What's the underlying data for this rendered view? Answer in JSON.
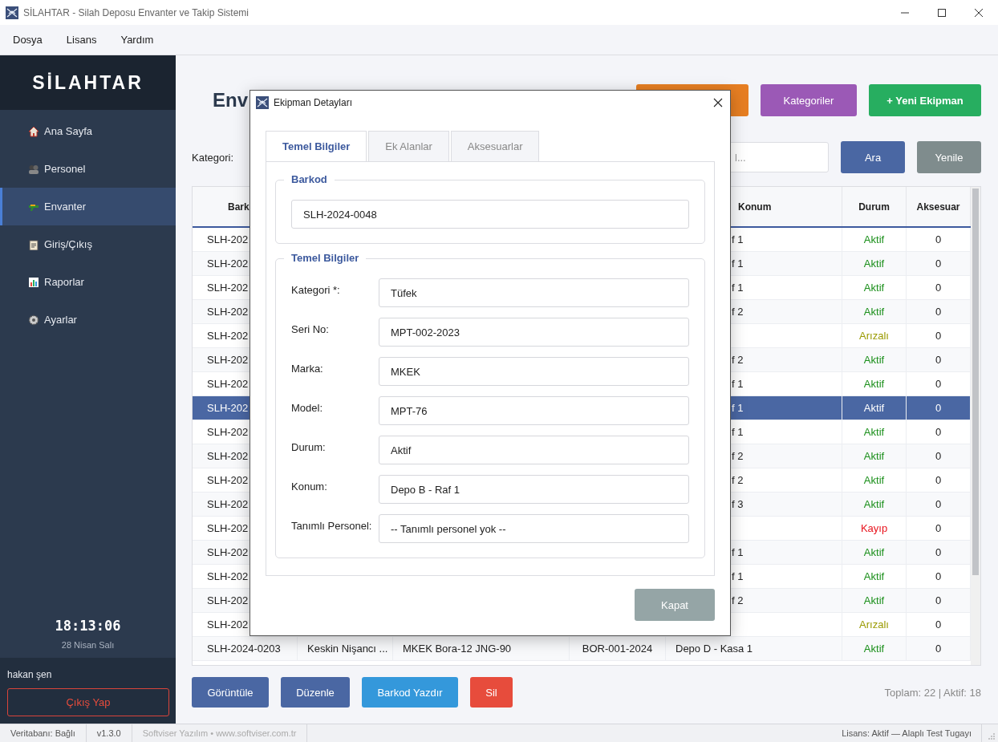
{
  "window": {
    "title": "SİLAHTAR - Silah Deposu Envanter ve Takip Sistemi"
  },
  "menu": [
    "Dosya",
    "Lisans",
    "Yardım"
  ],
  "sidebar": {
    "logo": "SİLAHTAR",
    "items": [
      {
        "label": "Ana Sayfa",
        "selected": false
      },
      {
        "label": "Personel",
        "selected": false
      },
      {
        "label": "Envanter",
        "selected": true
      },
      {
        "label": "Giriş/Çıkış",
        "selected": false
      },
      {
        "label": "Raporlar",
        "selected": false
      },
      {
        "label": "Ayarlar",
        "selected": false
      }
    ],
    "clock": "18:13:06",
    "date": "28 Nisan Salı",
    "user": "hakan şen",
    "logout": "Çıkış Yap"
  },
  "page": {
    "title": "Env",
    "header_buttons": [
      {
        "kind": "export"
      },
      {
        "label": "Kategoriler",
        "kind": "category"
      },
      {
        "label": "+ Yeni Ekipman",
        "kind": "new"
      }
    ]
  },
  "filter": {
    "label": "Kategori:",
    "search_placeholder": "l...",
    "buttons": [
      {
        "label": "Ara",
        "kind": "primary"
      },
      {
        "label": "Yenile",
        "kind": "secondary"
      }
    ]
  },
  "table": {
    "columns": [
      {
        "label": "Bark"
      },
      {},
      {},
      {},
      {
        "label": "Konum"
      },
      {
        "label": "Durum"
      },
      {
        "label": "Aksesuar"
      }
    ],
    "rows": [
      {
        "barkod": "SLH-202",
        "konum": "f 1",
        "durum": "Aktif",
        "kind": "active",
        "aksesuar": "0",
        "selected": false
      },
      {
        "barkod": "SLH-202",
        "konum": "f 1",
        "durum": "Aktif",
        "kind": "active",
        "aksesuar": "0",
        "selected": false
      },
      {
        "barkod": "SLH-202",
        "konum": "f 1",
        "durum": "Aktif",
        "kind": "active",
        "aksesuar": "0",
        "selected": false
      },
      {
        "barkod": "SLH-202",
        "konum": "f 2",
        "durum": "Aktif",
        "kind": "active",
        "aksesuar": "0",
        "selected": false
      },
      {
        "barkod": "SLH-202",
        "durum": "Arızalı",
        "kind": "faulty",
        "aksesuar": "0",
        "selected": false
      },
      {
        "barkod": "SLH-202",
        "konum": "f 2",
        "durum": "Aktif",
        "kind": "active",
        "aksesuar": "0",
        "selected": false
      },
      {
        "barkod": "SLH-202",
        "konum": "f 1",
        "durum": "Aktif",
        "kind": "active",
        "aksesuar": "0",
        "selected": false
      },
      {
        "barkod": "SLH-202",
        "konum": "f 1",
        "durum": "Aktif",
        "aksesuar": "0",
        "selected": true
      },
      {
        "barkod": "SLH-202",
        "konum": "f 1",
        "durum": "Aktif",
        "kind": "active",
        "aksesuar": "0",
        "selected": false
      },
      {
        "barkod": "SLH-202",
        "konum": "f 2",
        "durum": "Aktif",
        "kind": "active",
        "aksesuar": "0",
        "selected": false
      },
      {
        "barkod": "SLH-202",
        "konum": "f 2",
        "durum": "Aktif",
        "kind": "active",
        "aksesuar": "0",
        "selected": false
      },
      {
        "barkod": "SLH-202",
        "konum": "f 3",
        "durum": "Aktif",
        "kind": "active",
        "aksesuar": "0",
        "selected": false
      },
      {
        "barkod": "SLH-202",
        "durum": "Kayıp",
        "kind": "lost",
        "aksesuar": "0",
        "selected": false
      },
      {
        "barkod": "SLH-202",
        "konum": "f 1",
        "durum": "Aktif",
        "kind": "active",
        "aksesuar": "0",
        "selected": false
      },
      {
        "barkod": "SLH-202",
        "konum": "f 1",
        "durum": "Aktif",
        "kind": "active",
        "aksesuar": "0",
        "selected": false
      },
      {
        "barkod": "SLH-202",
        "konum": "f 2",
        "durum": "Aktif",
        "kind": "active",
        "aksesuar": "0",
        "selected": false
      },
      {
        "barkod": "SLH-202",
        "durum": "Arızalı",
        "kind": "faulty",
        "aksesuar": "0",
        "selected": false
      },
      {
        "barkod": "SLH-2024-0203",
        "column_2": "Keskin Nişancı ...",
        "column_3": "MKEK Bora-12 JNG-90",
        "column_4": "BOR-001-2024",
        "konum": "Depo D - Kasa 1",
        "durum": "Aktif",
        "kind": "active",
        "aksesuar": "0",
        "selected": false
      }
    ]
  },
  "actions": [
    {
      "label": "Görüntüle",
      "kind": "primary"
    },
    {
      "label": "Düzenle",
      "kind": "primary"
    },
    {
      "label": "Barkod Yazdır",
      "kind": "info"
    },
    {
      "label": "Sil",
      "kind": "danger"
    }
  ],
  "summary": "Toplam: 22 | Aktif: 18",
  "status_bar": {
    "left": [
      "Veritabanı: Bağlı",
      "v1.3.0",
      "Softviser Yazılım • www.softviser.com.tr"
    ],
    "right": "Lisans: Aktif — Alaplı Test Tugayı"
  },
  "dialog": {
    "title": "Ekipman Detayları",
    "tabs": [
      {
        "label": "Temel Bilgiler",
        "selected": true
      },
      {
        "label": "Ek Alanlar",
        "selected": false
      },
      {
        "label": "Aksesuarlar",
        "selected": false
      }
    ],
    "groups": [
      {
        "title": "Barkod",
        "fields": [
          {
            "value": "SLH-2024-0048"
          }
        ]
      },
      {
        "title": "Temel Bilgiler",
        "fields": [
          {
            "label": "Kategori *:",
            "value": "Tüfek"
          },
          {
            "label": "Seri No:",
            "value": "MPT-002-2023"
          },
          {
            "label": "Marka:",
            "value": "MKEK"
          },
          {
            "label": "Model:",
            "value": "MPT-76"
          },
          {
            "label": "Durum:",
            "value": "Aktif"
          },
          {
            "label": "Konum:",
            "value": "Depo B - Raf 1"
          },
          {
            "label": "Tanımlı Personel:",
            "value": "-- Tanımlı personel yok --"
          }
        ]
      }
    ],
    "close_button": "Kapat"
  }
}
